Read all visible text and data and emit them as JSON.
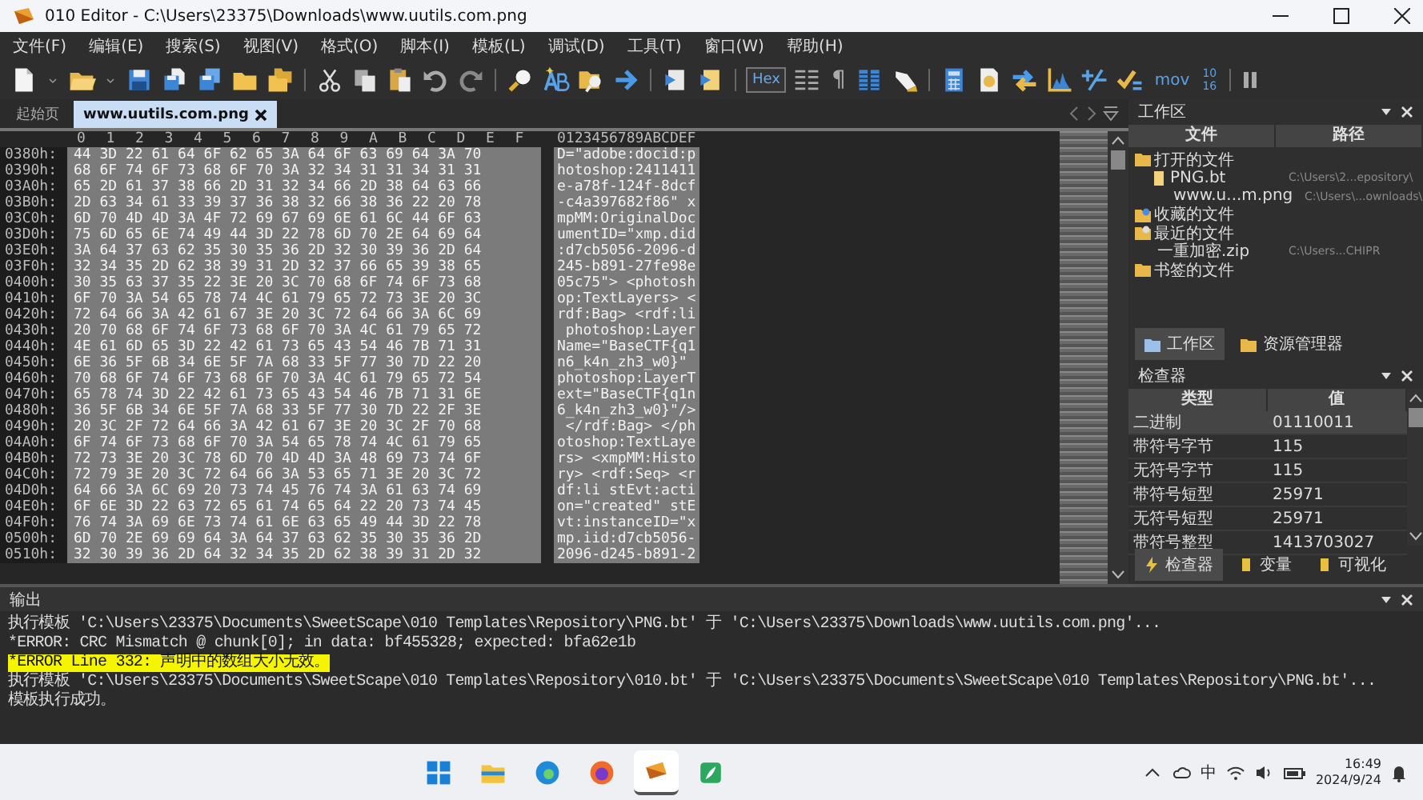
{
  "window": {
    "title": "010 Editor - C:\\Users\\23375\\Downloads\\www.uutils.com.png"
  },
  "menu": [
    "文件(F)",
    "编辑(E)",
    "搜索(S)",
    "视图(V)",
    "格式(O)",
    "脚本(I)",
    "模板(L)",
    "调试(D)",
    "工具(T)",
    "窗口(W)",
    "帮助(H)"
  ],
  "toolbar": {
    "hex_button": {
      "label": "Hex",
      "selected": true
    },
    "pilcrow": "¶",
    "mov_label": "mov",
    "base_labels": [
      "10",
      "16"
    ]
  },
  "tabs": [
    {
      "label": "起始页",
      "selected": false
    },
    {
      "label": "www.uutils.com.png",
      "selected": true
    }
  ],
  "hex_view": {
    "columns": [
      "0",
      "1",
      "2",
      "3",
      "4",
      "5",
      "6",
      "7",
      "8",
      "9",
      "A",
      "B",
      "C",
      "D",
      "E",
      "F"
    ],
    "ascii_header": "0123456789ABCDEF",
    "rows": [
      {
        "offset": "0380h:",
        "bytes": "44 3D 22 61 64 6F 62 65 3A 64 6F 63 69 64 3A 70",
        "ascii": "D=\"adobe:docid:p"
      },
      {
        "offset": "0390h:",
        "bytes": "68 6F 74 6F 73 68 6F 70 3A 32 34 31 31 34 31 31",
        "ascii": "hotoshop:2411411"
      },
      {
        "offset": "03A0h:",
        "bytes": "65 2D 61 37 38 66 2D 31 32 34 66 2D 38 64 63 66",
        "ascii": "e-a78f-124f-8dcf"
      },
      {
        "offset": "03B0h:",
        "bytes": "2D 63 34 61 33 39 37 36 38 32 66 38 36 22 20 78",
        "ascii": "-c4a397682f86\" x"
      },
      {
        "offset": "03C0h:",
        "bytes": "6D 70 4D 4D 3A 4F 72 69 67 69 6E 61 6C 44 6F 63",
        "ascii": "mpMM:OriginalDoc"
      },
      {
        "offset": "03D0h:",
        "bytes": "75 6D 65 6E 74 49 44 3D 22 78 6D 70 2E 64 69 64",
        "ascii": "umentID=\"xmp.did"
      },
      {
        "offset": "03E0h:",
        "bytes": "3A 64 37 63 62 35 30 35 36 2D 32 30 39 36 2D 64",
        "ascii": ":d7cb5056-2096-d"
      },
      {
        "offset": "03F0h:",
        "bytes": "32 34 35 2D 62 38 39 31 2D 32 37 66 65 39 38 65",
        "ascii": "245-b891-27fe98e"
      },
      {
        "offset": "0400h:",
        "bytes": "30 35 63 37 35 22 3E 20 3C 70 68 6F 74 6F 73 68",
        "ascii": "05c75\"> <photosh"
      },
      {
        "offset": "0410h:",
        "bytes": "6F 70 3A 54 65 78 74 4C 61 79 65 72 73 3E 20 3C",
        "ascii": "op:TextLayers> <"
      },
      {
        "offset": "0420h:",
        "bytes": "72 64 66 3A 42 61 67 3E 20 3C 72 64 66 3A 6C 69",
        "ascii": "rdf:Bag> <rdf:li"
      },
      {
        "offset": "0430h:",
        "bytes": "20 70 68 6F 74 6F 73 68 6F 70 3A 4C 61 79 65 72",
        "ascii": " photoshop:Layer"
      },
      {
        "offset": "0440h:",
        "bytes": "4E 61 6D 65 3D 22 42 61 73 65 43 54 46 7B 71 31",
        "ascii": "Name=\"BaseCTF{q1"
      },
      {
        "offset": "0450h:",
        "bytes": "6E 36 5F 6B 34 6E 5F 7A 68 33 5F 77 30 7D 22 20",
        "ascii": "n6_k4n_zh3_w0}\" "
      },
      {
        "offset": "0460h:",
        "bytes": "70 68 6F 74 6F 73 68 6F 70 3A 4C 61 79 65 72 54",
        "ascii": "photoshop:LayerT"
      },
      {
        "offset": "0470h:",
        "bytes": "65 78 74 3D 22 42 61 73 65 43 54 46 7B 71 31 6E",
        "ascii": "ext=\"BaseCTF{q1n"
      },
      {
        "offset": "0480h:",
        "bytes": "36 5F 6B 34 6E 5F 7A 68 33 5F 77 30 7D 22 2F 3E",
        "ascii": "6_k4n_zh3_w0}\"/>"
      },
      {
        "offset": "0490h:",
        "bytes": "20 3C 2F 72 64 66 3A 42 61 67 3E 20 3C 2F 70 68",
        "ascii": " </rdf:Bag> </ph"
      },
      {
        "offset": "04A0h:",
        "bytes": "6F 74 6F 73 68 6F 70 3A 54 65 78 74 4C 61 79 65",
        "ascii": "otoshop:TextLaye"
      },
      {
        "offset": "04B0h:",
        "bytes": "72 73 3E 20 3C 78 6D 70 4D 4D 3A 48 69 73 74 6F",
        "ascii": "rs> <xmpMM:Histo"
      },
      {
        "offset": "04C0h:",
        "bytes": "72 79 3E 20 3C 72 64 66 3A 53 65 71 3E 20 3C 72",
        "ascii": "ry> <rdf:Seq> <r"
      },
      {
        "offset": "04D0h:",
        "bytes": "64 66 3A 6C 69 20 73 74 45 76 74 3A 61 63 74 69",
        "ascii": "df:li stEvt:acti"
      },
      {
        "offset": "04E0h:",
        "bytes": "6F 6E 3D 22 63 72 65 61 74 65 64 22 20 73 74 45",
        "ascii": "on=\"created\" stE"
      },
      {
        "offset": "04F0h:",
        "bytes": "76 74 3A 69 6E 73 74 61 6E 63 65 49 44 3D 22 78",
        "ascii": "vt:instanceID=\"x"
      },
      {
        "offset": "0500h:",
        "bytes": "6D 70 2E 69 69 64 3A 64 37 63 62 35 30 35 36 2D",
        "ascii": "mp.iid:d7cb5056-"
      },
      {
        "offset": "0510h:",
        "bytes": "32 30 39 36 2D 64 32 34 35 2D 62 38 39 31 2D 32",
        "ascii": "2096-d245-b891-2"
      }
    ]
  },
  "workspace": {
    "title": "工作区",
    "columns": [
      "文件",
      "路径"
    ],
    "tree": [
      {
        "label": "打开的文件",
        "kind": "folder",
        "children": [
          {
            "label": "PNG.bt",
            "kind": "template",
            "path": "C:\\Users\\2...epository\\",
            "children": [
              {
                "label": "www.u...m.png",
                "kind": "file",
                "path": "C:\\Users\\...ownloads\\"
              }
            ]
          }
        ]
      },
      {
        "label": "收藏的文件",
        "kind": "favorites"
      },
      {
        "label": "最近的文件",
        "kind": "recent",
        "children": [
          {
            "label": "一重加密.zip",
            "kind": "file",
            "path": "C:\\Users...CHIPR"
          }
        ]
      },
      {
        "label": "书签的文件",
        "kind": "bookmarks"
      }
    ],
    "tabs": [
      {
        "label": "工作区",
        "selected": true
      },
      {
        "label": "资源管理器",
        "selected": false
      }
    ]
  },
  "inspector": {
    "title": "检查器",
    "columns": [
      "类型",
      "值"
    ],
    "rows": [
      {
        "type": "二进制",
        "value": "01110011",
        "selected": true
      },
      {
        "type": "带符号字节",
        "value": "115",
        "selected": false
      },
      {
        "type": "无符号字节",
        "value": "115",
        "selected": false
      },
      {
        "type": "带符号短型",
        "value": "25971",
        "selected": false
      },
      {
        "type": "无符号短型",
        "value": "25971",
        "selected": false
      },
      {
        "type": "带符号整型",
        "value": "1413703027",
        "selected": false
      }
    ],
    "tabs": [
      {
        "label": "检查器",
        "selected": true
      },
      {
        "label": "变量",
        "selected": false
      },
      {
        "label": "可视化",
        "selected": false
      }
    ]
  },
  "output": {
    "title": "输出",
    "lines": [
      {
        "text": "执行模板 'C:\\Users\\23375\\Documents\\SweetScape\\010 Templates\\Repository\\PNG.bt' 于 'C:\\Users\\23375\\Downloads\\www.uutils.com.png'...",
        "highlighted": false
      },
      {
        "text": "*ERROR: CRC Mismatch @ chunk[0]; in data: bf455328; expected: bfa62e1b",
        "highlighted": false
      },
      {
        "text": "*ERROR Line 332: 声明中的数组大小无效。",
        "highlighted": true
      },
      {
        "text": "执行模板 'C:\\Users\\23375\\Documents\\SweetScape\\010 Templates\\Repository\\010.bt' 于 'C:\\Users\\23375\\Documents\\SweetScape\\010 Templates\\Repository\\PNG.bt'...",
        "highlighted": false
      },
      {
        "text": "模板执行成功。",
        "highlighted": false
      }
    ]
  },
  "taskbar": {
    "apps": [
      {
        "kind": "start",
        "selected": false
      },
      {
        "kind": "explorer",
        "selected": false
      },
      {
        "kind": "edge",
        "selected": false
      },
      {
        "kind": "firefox",
        "selected": false
      },
      {
        "kind": "editor",
        "selected": true
      },
      {
        "kind": "green",
        "selected": false
      }
    ],
    "ime": "中",
    "time": "16:49",
    "date": "2024/9/24"
  }
}
